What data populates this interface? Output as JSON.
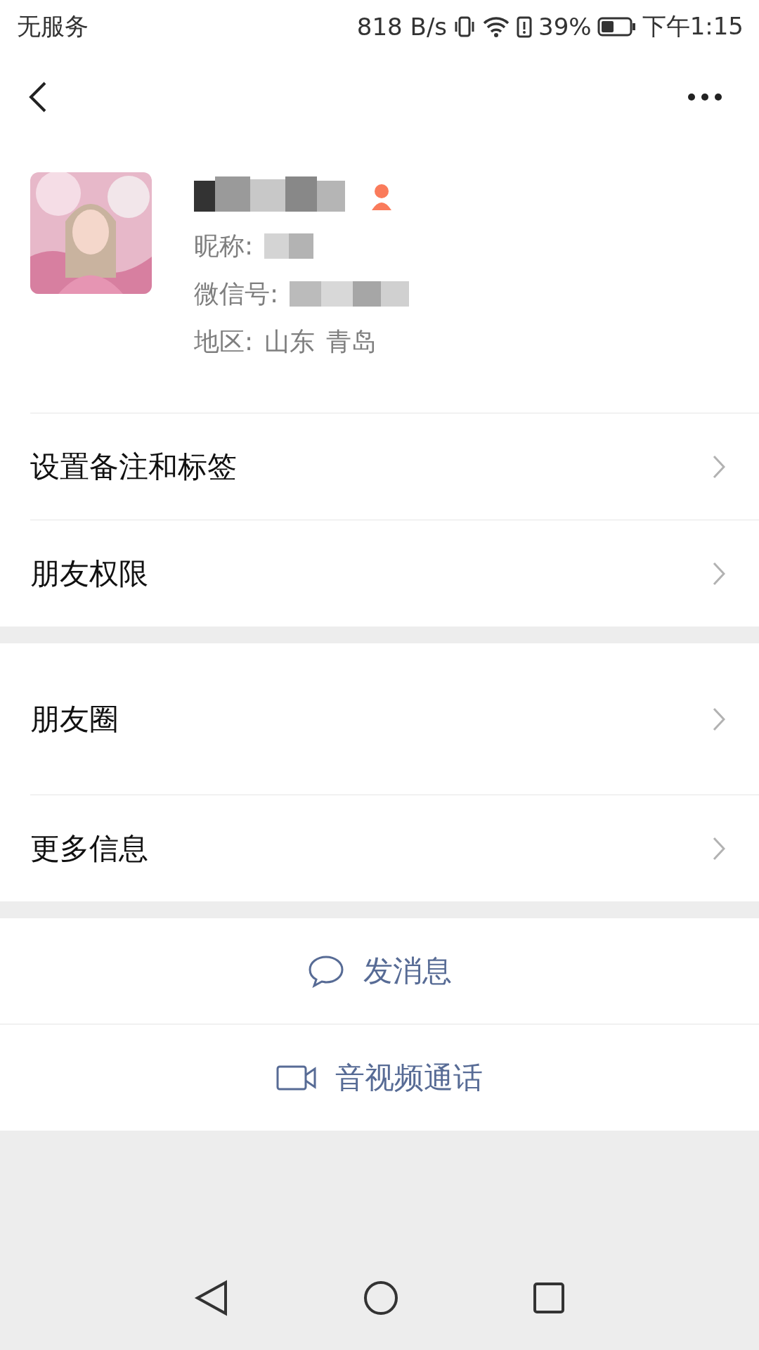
{
  "status_bar": {
    "carrier": "无服务",
    "speed": "818 B/s",
    "battery": "39%",
    "time": "下午1:15"
  },
  "profile": {
    "nickname_label": "昵称:",
    "wechat_id_label": "微信号:",
    "region_label": "地区:",
    "region": [
      "山东",
      "青岛"
    ]
  },
  "menu_groups": [
    [
      {
        "label": "设置备注和标签"
      },
      {
        "label": "朋友权限"
      }
    ],
    [
      {
        "label": "朋友圈",
        "tall": true
      },
      {
        "label": "更多信息",
        "tall": false
      }
    ]
  ],
  "actions": [
    {
      "kind": "message",
      "label": "发消息"
    },
    {
      "kind": "video",
      "label": "音视频通话"
    }
  ]
}
